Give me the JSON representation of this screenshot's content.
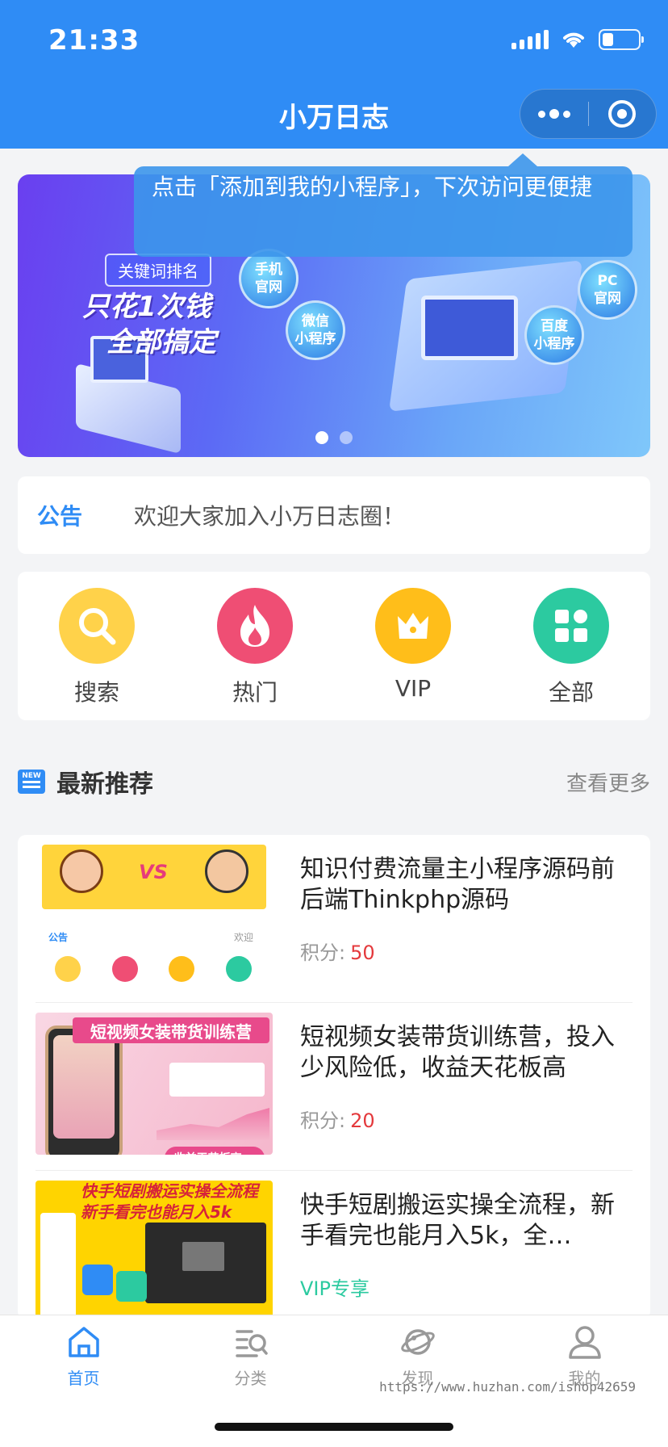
{
  "status": {
    "time": "21:33"
  },
  "header": {
    "title": "小万日志"
  },
  "tooltip": {
    "text": "点击「添加到我的小程序」，下次访问更便捷"
  },
  "banner": {
    "tag": "关键词排名",
    "headline_line1": "只花1次钱",
    "headline_line2": "全部搞定",
    "platforms": [
      "手机\n官网",
      "微信\n小程序",
      "百度\n小程序",
      "PC\n官网"
    ],
    "slide_count": 2,
    "active_slide": 1
  },
  "notice": {
    "label": "公告",
    "text": "欢迎大家加入小万日志圈！"
  },
  "quick": [
    {
      "label": "搜索",
      "icon": "search-icon"
    },
    {
      "label": "热门",
      "icon": "fire-icon"
    },
    {
      "label": "VIP",
      "icon": "crown-icon"
    },
    {
      "label": "全部",
      "icon": "grid-icon"
    }
  ],
  "section": {
    "title": "最新推荐",
    "more": "查看更多"
  },
  "items": [
    {
      "title": "知识付费流量主小程序源码前后端Thinkphp源码",
      "meta_label": "积分:",
      "points": "50",
      "thumb": {
        "vs": "VS",
        "notice": "公告",
        "welcome": "欢迎"
      }
    },
    {
      "title": "短视频女装带货训练营，投入少风险低，收益天花板高",
      "meta_label": "积分:",
      "points": "20",
      "thumb": {
        "banner": "短视频女装带货训练营",
        "chip": "收益天花板高 >"
      }
    },
    {
      "title": "快手短剧搬运实操全流程，新手看完也能月入5k，全…",
      "meta_label": "VIP专享",
      "points": "",
      "thumb": {
        "line1": "快手短剧搬运实操全流程",
        "line2": "新手看完也能月入5k"
      }
    }
  ],
  "tabs": [
    {
      "label": "首页",
      "icon": "home-icon",
      "active": true
    },
    {
      "label": "分类",
      "icon": "category-icon",
      "active": false
    },
    {
      "label": "发现",
      "icon": "planet-icon",
      "active": false
    },
    {
      "label": "我的",
      "icon": "user-icon",
      "active": false
    }
  ],
  "watermark": "https://www.huzhan.com/ishop42659",
  "colors": {
    "primary": "#2f8cf5",
    "points": "#e4393c",
    "vip": "#2ccaa0"
  }
}
